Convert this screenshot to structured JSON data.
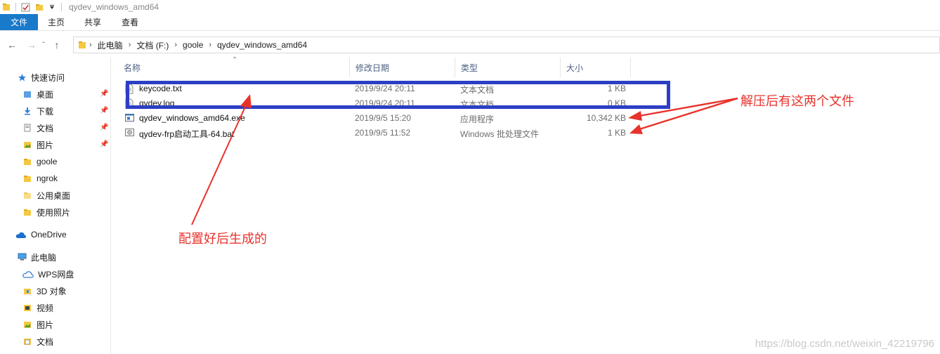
{
  "window": {
    "title": "qydev_windows_amd64"
  },
  "ribbon": {
    "tabs": [
      "文件",
      "主页",
      "共享",
      "查看"
    ]
  },
  "address": {
    "crumbs": [
      "此电脑",
      "文档 (F:)",
      "goole",
      "qydev_windows_amd64"
    ]
  },
  "sidebar": {
    "quick_access": "快速访问",
    "quick_items": [
      {
        "label": "桌面",
        "pinned": true
      },
      {
        "label": "下载",
        "pinned": true
      },
      {
        "label": "文档",
        "pinned": true
      },
      {
        "label": "图片",
        "pinned": true
      },
      {
        "label": "goole",
        "pinned": false
      },
      {
        "label": "ngrok",
        "pinned": false
      },
      {
        "label": "公用桌面",
        "pinned": false
      },
      {
        "label": "使用照片",
        "pinned": false
      }
    ],
    "onedrive": "OneDrive",
    "this_pc": "此电脑",
    "pc_items": [
      "WPS网盘",
      "3D 对象",
      "视频",
      "图片",
      "文档"
    ]
  },
  "columns": {
    "name": "名称",
    "date": "修改日期",
    "type": "类型",
    "size": "大小"
  },
  "files": [
    {
      "name": "keycode.txt",
      "date": "2019/9/24 20:11",
      "type": "文本文档",
      "size": "1 KB",
      "icon": "text-file-icon"
    },
    {
      "name": "qydev.log",
      "date": "2019/9/24 20:11",
      "type": "文本文档",
      "size": "0 KB",
      "icon": "text-file-icon"
    },
    {
      "name": "qydev_windows_amd64.exe",
      "date": "2019/9/5 15:20",
      "type": "应用程序",
      "size": "10,342 KB",
      "icon": "exe-file-icon"
    },
    {
      "name": "qydev-frp启动工具-64.bat",
      "date": "2019/9/5 11:52",
      "type": "Windows 批处理文件",
      "size": "1 KB",
      "icon": "bat-file-icon"
    }
  ],
  "annotations": {
    "right": "解压后有这两个文件",
    "bottom": "配置好后生成的",
    "color": "#e8322c"
  },
  "watermark": "https://blog.csdn.net/weixin_42219796",
  "colors": {
    "accent": "#1979ca",
    "highlight_box": "#2c3fc4"
  }
}
